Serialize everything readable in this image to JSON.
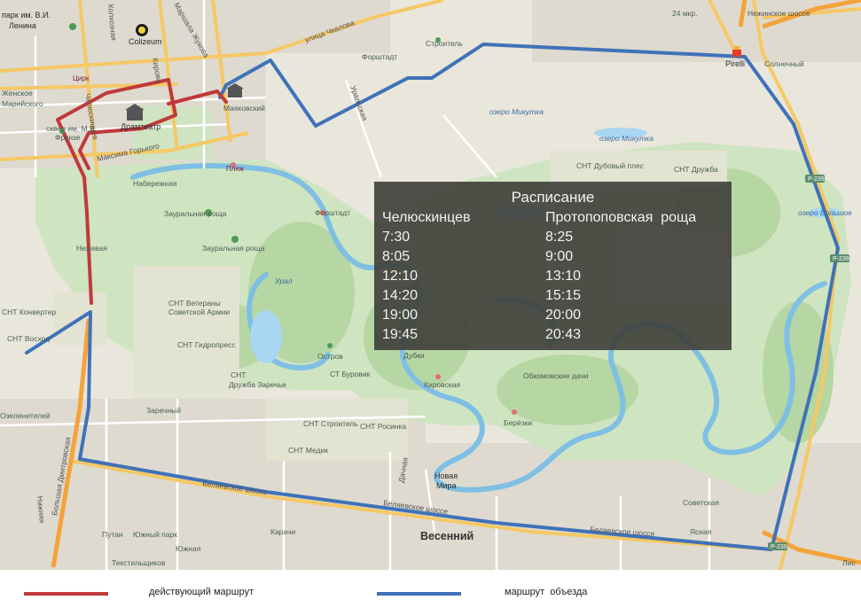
{
  "schedule": {
    "title": "Расписание",
    "stop_a": "Челюскинцев",
    "stop_b": "Протопоповская  роща",
    "times_a": [
      "7:30",
      "8:05",
      "12:10",
      "14:20",
      "19:00",
      "19:45"
    ],
    "times_b": [
      "8:25",
      "9:00",
      "13:10",
      "15:15",
      "20:00",
      "20:43"
    ]
  },
  "legend": {
    "active_route": "действующий маршрут",
    "detour_route": "маршрут  объезда",
    "active_color": "#c0393b",
    "detour_color": "#3f72b8"
  },
  "map_labels": {
    "park_lenina": "парк им. В.И.",
    "park_lenina_2": "Ленина",
    "colizeum": "Colizeum",
    "tsirk": "Цирк",
    "dramteatr": "Драмтеатр",
    "skver_frunze": "сквер им. М.В.",
    "skver_frunze_2": "Фрунзе",
    "maksima_gorkogo": "Максима Горького",
    "naberezhnaya": "Набережная",
    "plyazh": "Пляж",
    "zauralnaya_roshcha": "Зауральная роща",
    "zauralnaya_roshcha_2": "Зауральная роща",
    "forshtadt_1": "Форштадт",
    "forshtadt_2": "Форштадт",
    "stroitel": "Строитель",
    "ulitsa_chkalova": "улица Чкалова",
    "uralskaya": "Уральская",
    "marshala_zhukova": "Маршала Жукова",
    "mayakovsky": "Маяковский",
    "ozero_mikutka_1": "озеро Микутка",
    "ozero_mikutka_2": "озеро Микутка",
    "snt_dubovy_ples": "СНТ Дубовый плес",
    "snt_druzhba_1": "СНТ Дружба",
    "pirelli": "Pirelli",
    "solnechny": "Солнечный",
    "nezhinskoe_shosse": "Нежинское шоссе",
    "mkr_24": "24 мкр.",
    "ozero_bolshoe": "озеро Большое",
    "r239_1": "Р-239",
    "r239_2": "Р-239",
    "r239_3": "Р-239",
    "ural_river": "Урал",
    "snt_veterany": "СНТ Ветераны",
    "snt_veterany_2": "Советской Армии",
    "snt_gidropress": "СНТ Гидропресс",
    "snt_konverter": "СНТ Конвертер",
    "snt_voskhod": "СНТ Восход",
    "snt_druzhba_zarechye": "СНТ",
    "snt_druzhba_zarechye_2": "Дружба Заречье",
    "zarechny": "Заречный",
    "ozelenitelei": "Озеленителей",
    "ostrov": "Остров",
    "snt_burovik": "СТ Буровик",
    "kirovskaya": "Кировская",
    "dubki": "Дубки",
    "obkomovskie_dachi": "Обкомовские дачи",
    "beryozki": "Берёзки",
    "snt_stroitel": "СНТ Строитель",
    "snt_rosinka": "СНТ Росинка",
    "snt_medik": "СНТ Медик",
    "novaya_mira": "Новая",
    "novaya_mira_2": "Мира",
    "dachnaya": "Дачная",
    "belyaevskoe_shosse_1": "Беляевское шоссе",
    "belyaevskoe_shosse_2": "Беляевское шоссе",
    "belyaevskoe_shosse_3": "Беляевское шоссе",
    "vesenny": "Весенний",
    "sovetskaya": "Советская",
    "yasnaya": "Ясная",
    "karachi": "Карачи",
    "putan": "Путан",
    "yuzhny_park": "Южный парк",
    "yuzhnaya": "Южная",
    "tekstilshchikov": "Текстильщиков",
    "nizhnyaya": "Нижняя",
    "lis": "Лис",
    "kirova": "Кирова",
    "chelyuskintsev_street": "Челюскинцев",
    "kolhoznaya": "Колхозная",
    "bolshaya_dmitrovskaya": "Большая Дмитровская",
    "zhenskoe": "Женское",
    "mariskogo": "Марийского",
    "kuzhevaya": "Нежевая"
  }
}
